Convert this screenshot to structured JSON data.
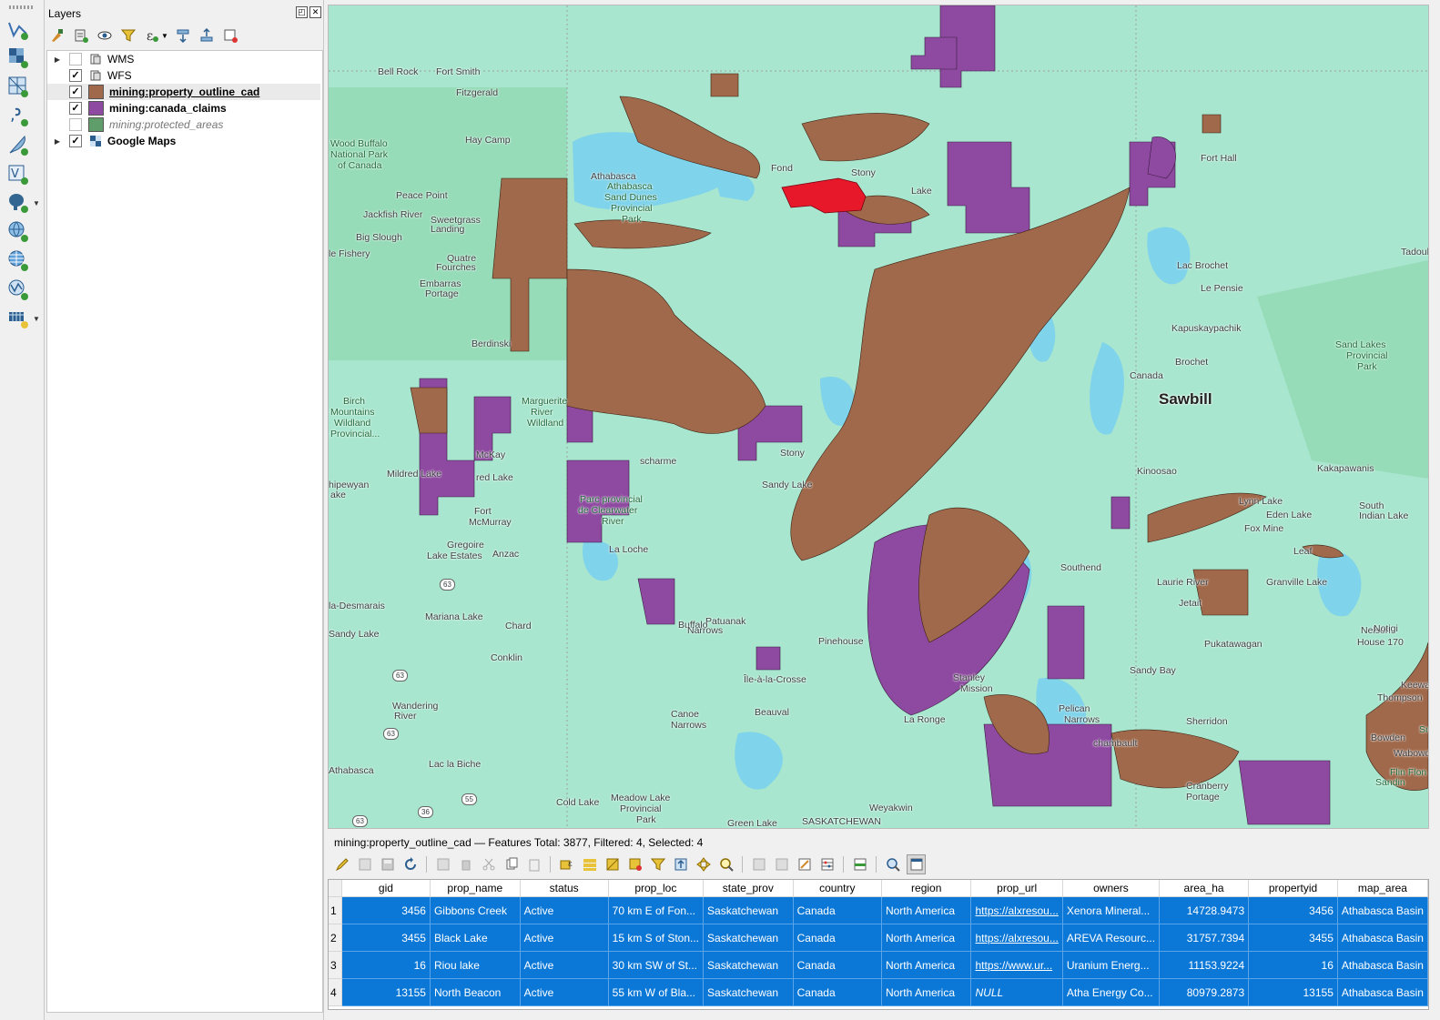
{
  "layers_panel": {
    "title": "Layers",
    "layers": [
      {
        "label": "WMS",
        "checked": false,
        "expandable": true,
        "kind": "service"
      },
      {
        "label": "WFS",
        "checked": true,
        "expandable": false,
        "kind": "service"
      },
      {
        "label": "mining:property_outline_cad",
        "checked": true,
        "color": "#a0694b",
        "kind": "vector"
      },
      {
        "label": "mining:canada_claims",
        "checked": true,
        "color": "#8e4aa0",
        "kind": "vector"
      },
      {
        "label": "mining:protected_areas",
        "checked": false,
        "color": "#5f9e6a",
        "kind": "vector"
      },
      {
        "label": "Google Maps",
        "checked": true,
        "expandable": true,
        "kind": "tiles"
      }
    ]
  },
  "map": {
    "places": [
      {
        "name": "Bell Rock"
      },
      {
        "name": "Fort Smith"
      },
      {
        "name": "Fitzgerald"
      },
      {
        "name": "Wood Buffalo"
      },
      {
        "name": "National Park"
      },
      {
        "name": "of Canada"
      },
      {
        "name": "Hay Camp"
      },
      {
        "name": "Athabasca"
      },
      {
        "name": "Athabasca"
      },
      {
        "name": "Sand Dunes"
      },
      {
        "name": "Provincial"
      },
      {
        "name": "Park"
      },
      {
        "name": "Peace Point"
      },
      {
        "name": "Jackfish River"
      },
      {
        "name": "Sweetgrass"
      },
      {
        "name": "Landing"
      },
      {
        "name": "Big Slough"
      },
      {
        "name": "le Fishery"
      },
      {
        "name": "Quatre"
      },
      {
        "name": "Fourches"
      },
      {
        "name": "Embarras"
      },
      {
        "name": "Portage"
      },
      {
        "name": "Berdinski"
      },
      {
        "name": "Birch"
      },
      {
        "name": "Mountains"
      },
      {
        "name": "Wildland"
      },
      {
        "name": "Provincial..."
      },
      {
        "name": "Marguerite"
      },
      {
        "name": "River"
      },
      {
        "name": "Wildland"
      },
      {
        "name": "Mildred Lake"
      },
      {
        "name": "McKay"
      },
      {
        "name": "red Lake"
      },
      {
        "name": "hipewyan"
      },
      {
        "name": "ake"
      },
      {
        "name": "Fort"
      },
      {
        "name": "McMurray"
      },
      {
        "name": "Gregoire"
      },
      {
        "name": "Lake Estates"
      },
      {
        "name": "Anzac"
      },
      {
        "name": "La Loche"
      },
      {
        "name": "Parc provincial"
      },
      {
        "name": "de Clearwater"
      },
      {
        "name": "River"
      },
      {
        "name": "scharme"
      },
      {
        "name": "Stony"
      },
      {
        "name": "Sandy Lake"
      },
      {
        "name": "Fond"
      },
      {
        "name": "Stony"
      },
      {
        "name": "Lake"
      },
      {
        "name": "Fort Hall"
      },
      {
        "name": "Lac Brochet"
      },
      {
        "name": "Le Pensie"
      },
      {
        "name": "Kapuskaypachik"
      },
      {
        "name": "Brochet"
      },
      {
        "name": "Canada"
      },
      {
        "name": "Sawbill"
      },
      {
        "name": "Sand Lakes"
      },
      {
        "name": "Provincial"
      },
      {
        "name": "Park"
      },
      {
        "name": "Tadoule"
      },
      {
        "name": "Kinoosao"
      },
      {
        "name": "Kakapawanis"
      },
      {
        "name": "Lynn Lake"
      },
      {
        "name": "Eden Lake"
      },
      {
        "name": "South"
      },
      {
        "name": "Indian Lake"
      },
      {
        "name": "Fox Mine"
      },
      {
        "name": "Leaf"
      },
      {
        "name": "Laurie River"
      },
      {
        "name": "Granville Lake"
      },
      {
        "name": "Jetait"
      },
      {
        "name": "Nelson"
      },
      {
        "name": "House 170"
      },
      {
        "name": "Pukatawagan"
      },
      {
        "name": "Sandy Bay"
      },
      {
        "name": "Southend"
      },
      {
        "name": "Pelican"
      },
      {
        "name": "Narrows"
      },
      {
        "name": "Sherridon"
      },
      {
        "name": "Cranberry"
      },
      {
        "name": "Portage"
      },
      {
        "name": "La Ronge"
      },
      {
        "name": "Stanley"
      },
      {
        "name": "Mission"
      },
      {
        "name": "Pinehouse"
      },
      {
        "name": "Île-à-la-Crosse"
      },
      {
        "name": "Beauval"
      },
      {
        "name": "Canoe"
      },
      {
        "name": "Narrows"
      },
      {
        "name": "Patuanak"
      },
      {
        "name": "Buffalo"
      },
      {
        "name": "Narrows"
      },
      {
        "name": "Chard"
      },
      {
        "name": "Conklin"
      },
      {
        "name": "Mariana Lake"
      },
      {
        "name": "la-Desmarais"
      },
      {
        "name": "Sandy Lake"
      },
      {
        "name": "Wandering"
      },
      {
        "name": "River"
      },
      {
        "name": "Lac la Biche"
      },
      {
        "name": "Athabasca"
      },
      {
        "name": "Cold Lake"
      },
      {
        "name": "Meadow Lake"
      },
      {
        "name": "Provincial"
      },
      {
        "name": "Park"
      },
      {
        "name": "Weyakwin"
      },
      {
        "name": "Green Lake"
      },
      {
        "name": "SASKATCHEWAN"
      },
      {
        "name": "Flin Flon"
      },
      {
        "name": "Sandin"
      },
      {
        "name": "Snow Lake"
      },
      {
        "name": "Bowden"
      },
      {
        "name": "Wabowden"
      },
      {
        "name": "Notigi"
      },
      {
        "name": "Thompson"
      },
      {
        "name": "Keewatin"
      },
      {
        "name": "chambault"
      }
    ],
    "routes": [
      "63",
      "63",
      "63",
      "63",
      "36",
      "55"
    ]
  },
  "attribute_table": {
    "title": "mining:property_outline_cad — Features Total: 3877, Filtered: 4, Selected: 4",
    "columns": [
      "gid",
      "prop_name",
      "status",
      "prop_loc",
      "state_prov",
      "country",
      "region",
      "prop_url",
      "owners",
      "area_ha",
      "propertyid",
      "map_area"
    ],
    "rows": [
      {
        "n": "1",
        "cells": [
          "3456",
          "Gibbons Creek",
          "Active",
          "70 km E of Fon...",
          "Saskatchewan",
          "Canada",
          "North America",
          "https://alxresou...",
          "Xenora Mineral...",
          "14728.9473",
          "3456",
          "Athabasca Basin"
        ]
      },
      {
        "n": "2",
        "cells": [
          "3455",
          "Black Lake",
          "Active",
          "15 km S of Ston...",
          "Saskatchewan",
          "Canada",
          "North America",
          "https://alxresou...",
          "AREVA Resourc...",
          "31757.7394",
          "3455",
          "Athabasca Basin"
        ]
      },
      {
        "n": "3",
        "cells": [
          "16",
          "Riou lake",
          "Active",
          "30 km SW of St...",
          "Saskatchewan",
          "Canada",
          "North America",
          "https://www.ur...",
          "Uranium Energ...",
          "11153.9224",
          "16",
          "Athabasca Basin"
        ]
      },
      {
        "n": "4",
        "cells": [
          "13155",
          "North Beacon",
          "Active",
          "55 km W of Bla...",
          "Saskatchewan",
          "Canada",
          "North America",
          "NULL",
          "Atha Energy Co...",
          "80979.2873",
          "13155",
          "Athabasca Basin"
        ]
      }
    ]
  },
  "colors": {
    "property_fill": "#a0694b",
    "claims_fill": "#8e4aa0",
    "selected_fill": "#e8182b",
    "water": "#7fd3ea",
    "land": "#a8e6cf",
    "selection_row": "#0b78d7"
  }
}
